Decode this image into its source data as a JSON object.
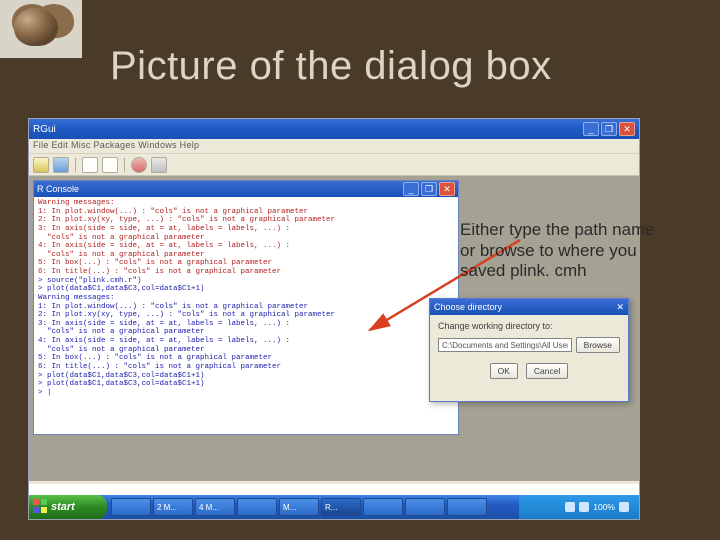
{
  "slide": {
    "title": "Picture of the dialog box",
    "callout": "Either type the path name or browse to where you saved plink. cmh"
  },
  "rgui": {
    "title": "RGui",
    "menubar": "File  Edit  Misc  Packages  Windows  Help"
  },
  "console": {
    "title": "R Console",
    "text_red": "Warning messages:\n1: In plot.window(...) : \"cols\" is not a graphical parameter\n2: In plot.xy(xy, type, ...) : \"cols\" is not a graphical parameter\n3: In axis(side = side, at = at, labels = labels, ...) :\n  \"cols\" is not a graphical parameter\n4: In axis(side = side, at = at, labels = labels, ...) :\n  \"cols\" is not a graphical parameter\n5: In box(...) : \"cols\" is not a graphical parameter\n6: In title(...) : \"cols\" is not a graphical parameter",
    "text_blue": "> source(\"plink.cmh.r\")\n> plot(data$C1,data$C3,col=data$C1+1)\nWarning messages:\n1: In plot.window(...) : \"cols\" is not a graphical parameter\n2: In plot.xy(xy, type, ...) : \"cols\" is not a graphical parameter\n3: In axis(side = side, at = at, labels = labels, ...) :\n  \"cols\" is not a graphical parameter\n4: In axis(side = side, at = at, labels = labels, ...) :\n  \"cols\" is not a graphical parameter\n5: In box(...) : \"cols\" is not a graphical parameter\n6: In title(...) : \"cols\" is not a graphical parameter\n> plot(data$C1,data$C3,col=data$C1+1)\n> plot(data$C1,data$C3,col=data$C1+1)\n> |"
  },
  "dialog": {
    "title": "Choose directory",
    "label": "Change working directory to:",
    "path_value": "C:\\Documents and Settings\\All Users",
    "browse": "Browse",
    "ok": "OK",
    "cancel": "Cancel"
  },
  "taskbar": {
    "start": "start",
    "items": [
      "",
      "2 M...",
      "4 M...",
      "",
      "M...",
      "R...",
      "",
      "",
      ""
    ],
    "tray_pct": "100%",
    "clock": ""
  }
}
